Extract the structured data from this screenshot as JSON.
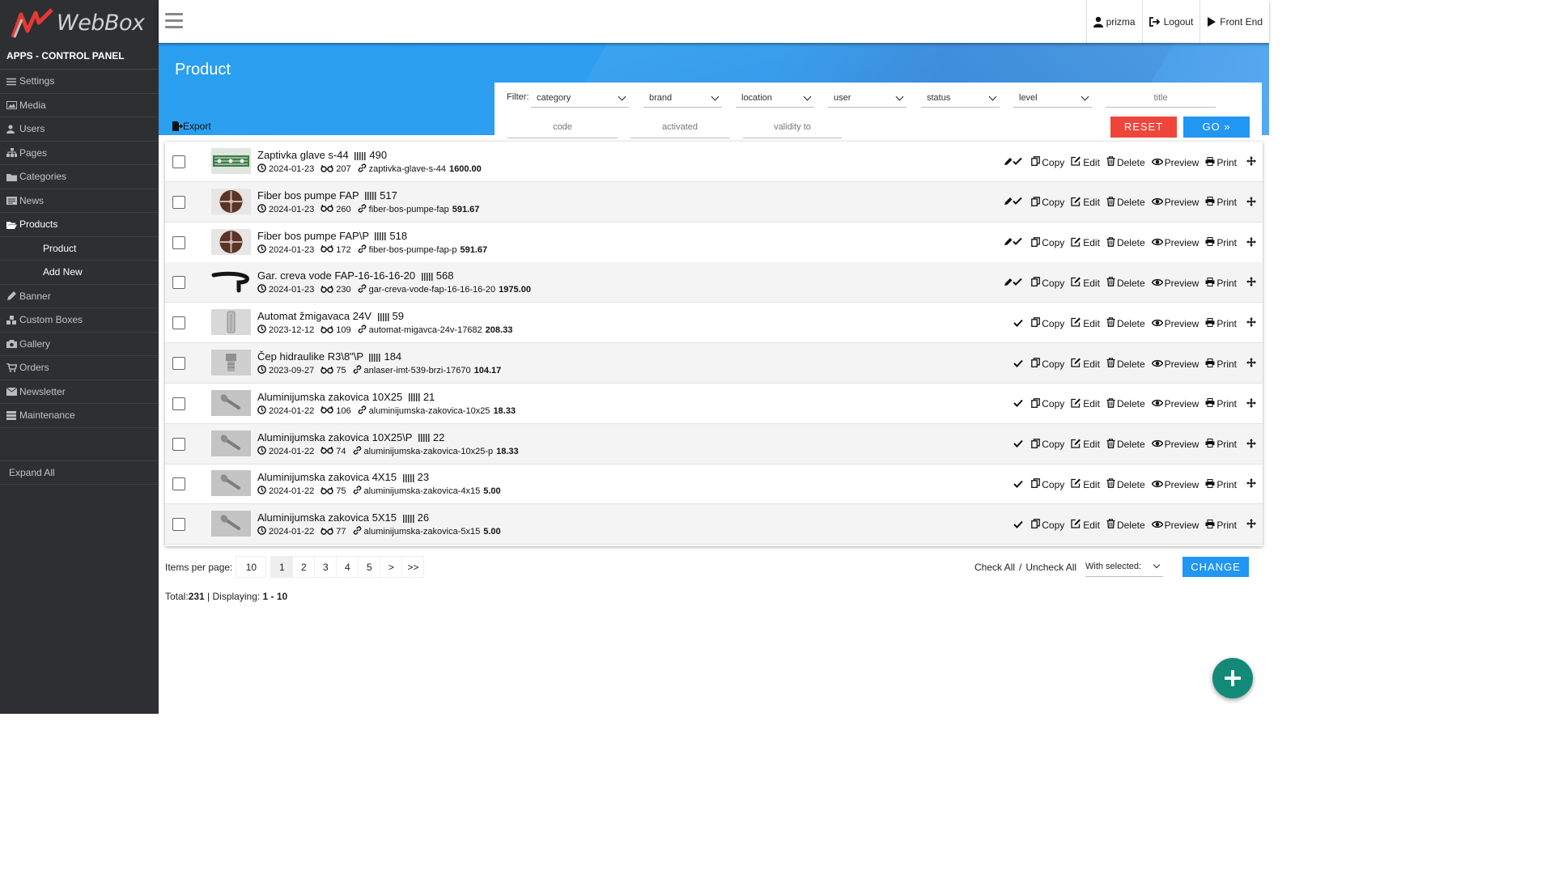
{
  "app": {
    "logo_text": "WebBox",
    "panel_title": "APPS - CONTROL PANEL"
  },
  "sidebar": {
    "items": [
      {
        "label": "Settings",
        "icon": "sliders-icon"
      },
      {
        "label": "Media",
        "icon": "image-icon"
      },
      {
        "label": "Users",
        "icon": "user-icon"
      },
      {
        "label": "Pages",
        "icon": "sitemap-icon"
      },
      {
        "label": "Categories",
        "icon": "folder-icon"
      },
      {
        "label": "News",
        "icon": "newspaper-icon"
      },
      {
        "label": "Products",
        "icon": "folder-open-icon"
      },
      {
        "label": "Banner",
        "icon": "pen-icon"
      },
      {
        "label": "Custom Boxes",
        "icon": "cubes-icon"
      },
      {
        "label": "Gallery",
        "icon": "camera-icon"
      },
      {
        "label": "Orders",
        "icon": "cart-icon"
      },
      {
        "label": "Newsletter",
        "icon": "envelope-icon"
      },
      {
        "label": "Maintenance",
        "icon": "server-icon"
      }
    ],
    "sub_items": [
      {
        "label": "Product"
      },
      {
        "label": "Add New"
      }
    ],
    "expand_all": "Expand All"
  },
  "topbar": {
    "user": "prizma",
    "logout": "Logout",
    "front_end": "Front End"
  },
  "page": {
    "title": "Product",
    "export": "Export"
  },
  "filter": {
    "label": "Filter:",
    "selects": [
      "category",
      "brand",
      "location",
      "user",
      "status",
      "level"
    ],
    "title_placeholder": "title",
    "code_placeholder": "code",
    "activated_placeholder": "activated",
    "validity_placeholder": "validity to",
    "reset": "RESET",
    "go": "GO »"
  },
  "actions": {
    "copy": "Copy",
    "edit": "Edit",
    "delete": "Delete",
    "preview": "Preview",
    "print": "Print"
  },
  "products": [
    {
      "title": "Zaptivka glave s-44",
      "id": "490",
      "date": "2024-01-23",
      "views": "207",
      "slug": "zaptivka-glave-s-44",
      "price": "1600.00",
      "status_icon": "pen-check-icon",
      "thumb": "green"
    },
    {
      "title": "Fiber bos pumpe FAP",
      "id": "517",
      "date": "2024-01-23",
      "views": "260",
      "slug": "fiber-bos-pumpe-fap",
      "price": "591.67",
      "status_icon": "pen-check-icon",
      "thumb": "disc"
    },
    {
      "title": "Fiber bos pumpe FAP\\P",
      "id": "518",
      "date": "2024-01-23",
      "views": "172",
      "slug": "fiber-bos-pumpe-fap-p",
      "price": "591.67",
      "status_icon": "pen-check-icon",
      "thumb": "disc"
    },
    {
      "title": "Gar. creva vode FAP-16-16-16-20",
      "id": "568",
      "date": "2024-01-23",
      "views": "230",
      "slug": "gar-creva-vode-fap-16-16-16-20",
      "price": "1975.00",
      "status_icon": "pen-check-icon",
      "thumb": "hose"
    },
    {
      "title": "Automat žmigavaca 24V",
      "id": "59",
      "date": "2023-12-12",
      "views": "109",
      "slug": "automat-migavca-24v-17682",
      "price": "208.33",
      "status_icon": "check-icon",
      "thumb": "relay"
    },
    {
      "title": "Čep hidraulike R3\\8\"\\P",
      "id": "184",
      "date": "2023-09-27",
      "views": "75",
      "slug": "anlaser-imt-539-brzi-17670",
      "price": "104.17",
      "status_icon": "check-icon",
      "thumb": "plug"
    },
    {
      "title": "Aluminijumska zakovica 10X25",
      "id": "21",
      "date": "2024-01-22",
      "views": "106",
      "slug": "aluminijumska-zakovica-10x25",
      "price": "18.33",
      "status_icon": "check-icon",
      "thumb": "rivet"
    },
    {
      "title": "Aluminijumska zakovica 10X25\\P",
      "id": "22",
      "date": "2024-01-22",
      "views": "74",
      "slug": "aluminijumska-zakovica-10x25-p",
      "price": "18.33",
      "status_icon": "check-icon",
      "thumb": "rivet"
    },
    {
      "title": "Aluminijumska zakovica 4X15",
      "id": "23",
      "date": "2024-01-22",
      "views": "75",
      "slug": "aluminijumska-zakovica-4x15",
      "price": "5.00",
      "status_icon": "check-icon",
      "thumb": "rivet"
    },
    {
      "title": "Aluminijumska zakovica 5X15",
      "id": "26",
      "date": "2024-01-22",
      "views": "77",
      "slug": "aluminijumska-zakovica-5x15",
      "price": "5.00",
      "status_icon": "check-icon",
      "thumb": "rivet"
    }
  ],
  "pagination": {
    "items_per_page_label": "Items per page:",
    "items_per_page": "10",
    "pages": [
      "1",
      "2",
      "3",
      "4",
      "5",
      ">",
      ">>"
    ],
    "current": "1"
  },
  "bulk": {
    "check_all": "Check All",
    "separator": "/",
    "uncheck_all": "Uncheck All",
    "with_selected": "With selected:",
    "change": "CHANGE"
  },
  "totals": {
    "label": "Total:",
    "total": "231",
    "displaying_label": " | Displaying: ",
    "range": "1 - 10"
  }
}
